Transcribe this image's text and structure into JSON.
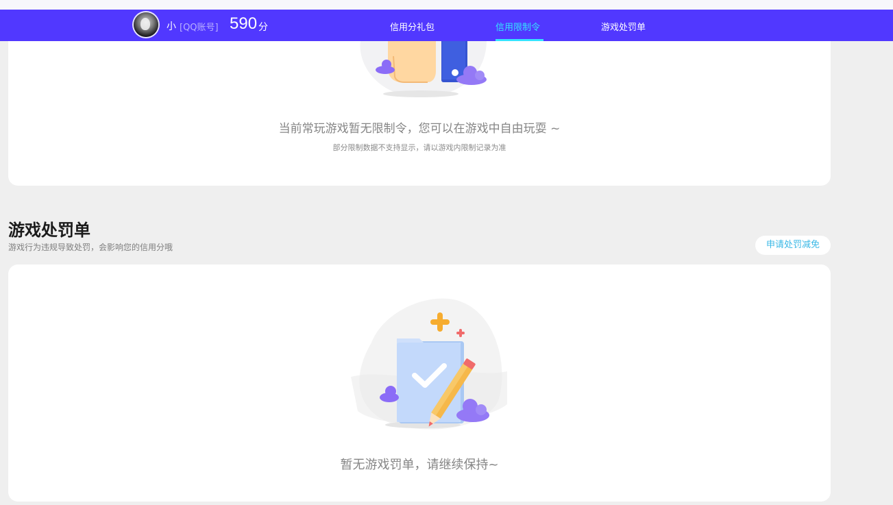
{
  "header": {
    "username": "小",
    "account_type": "[QQ账号]",
    "score": "590",
    "score_unit": "分",
    "tabs": [
      {
        "label": "信用分礼包",
        "active": false
      },
      {
        "label": "信用限制令",
        "active": true
      },
      {
        "label": "游戏处罚单",
        "active": false
      }
    ],
    "colors": {
      "bar": "#5138ff",
      "active": "#35e3ff"
    }
  },
  "restriction": {
    "empty_title": "当前常玩游戏暂无限制令，您可以在游戏中自由玩耍 ~",
    "empty_note": "部分限制数据不支持显示，请以游戏内限制记录为准"
  },
  "punishment": {
    "title": "游戏处罚单",
    "description": "游戏行为违规导致处罚，会影响您的信用分哦",
    "appeal_button": "申请处罚减免",
    "empty_title": "暂无游戏罚单，请继续保持~"
  },
  "icons": [
    "phone-hand-illustration",
    "cloud-icon",
    "checklist-pencil-illustration",
    "sparkle-icon"
  ]
}
